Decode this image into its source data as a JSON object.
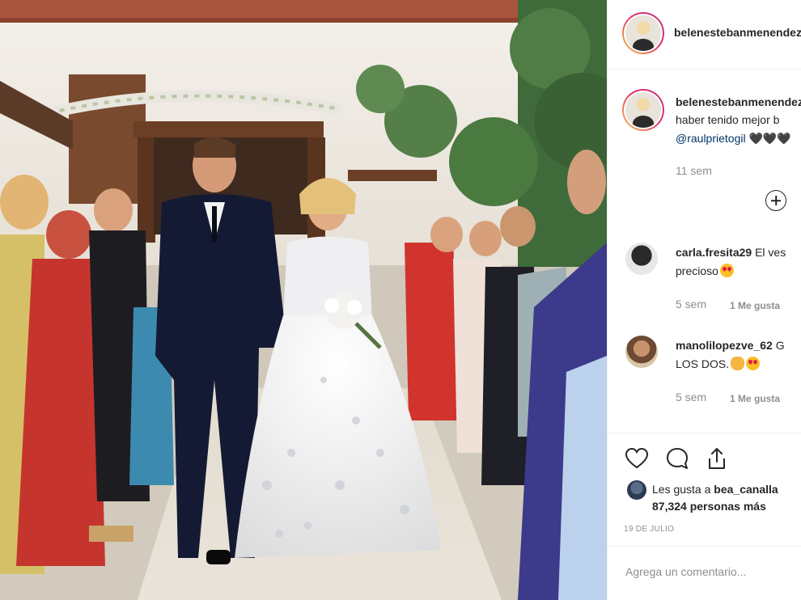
{
  "post": {
    "author": "belenestebanmenendez",
    "caption": {
      "author": "belenestebanmenendez",
      "line1": "",
      "line1_visible": "haber tenido mejor b",
      "mention": "@raulprietogil",
      "hearts": "🖤🖤🖤",
      "age": "11 sem"
    },
    "comments": [
      {
        "user": "carla.fresita29",
        "text_start": "El ves",
        "text_line2": "precioso",
        "emoji": "heart-eyes",
        "age": "5 sem",
        "likes": "1 Me gusta"
      },
      {
        "user": "manolilopezve_62",
        "text_start": "G",
        "text_line2": "LOS DOS.",
        "emoji": "clap+heart-eyes",
        "age": "5 sem",
        "likes": "1 Me gusta"
      }
    ],
    "likes": {
      "prefix": "Les gusta a",
      "user": "bea_canalla",
      "rest": "87,324 personas más"
    },
    "date": "19 DE JULIO",
    "add_comment_placeholder": "Agrega un comentario..."
  },
  "icons": [
    "heart-icon",
    "comment-icon",
    "share-icon",
    "plus-circle-icon"
  ],
  "colors": {
    "link": "#003569",
    "muted": "#8e8e8e",
    "text": "#262626"
  }
}
